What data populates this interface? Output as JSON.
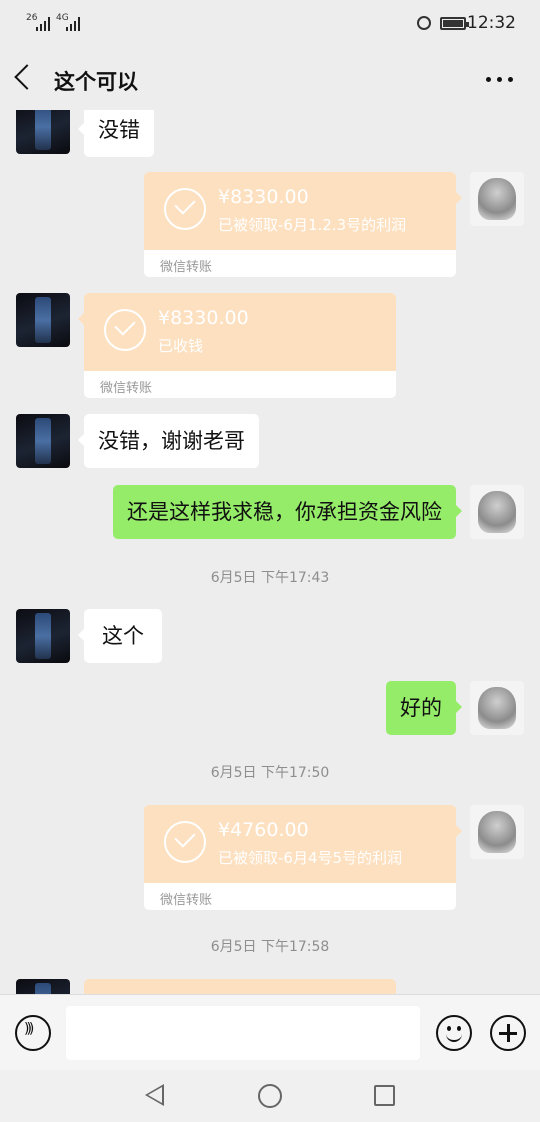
{
  "status_bar": {
    "signal_1": "26",
    "signal_2": "4G",
    "time": "12:32"
  },
  "nav": {
    "title": "这个可以"
  },
  "messages": {
    "m1": "没错",
    "t1": {
      "amount": "¥8330.00",
      "note": "已被领取-6月1.2.3号的利润",
      "footer": "微信转账"
    },
    "t2": {
      "amount": "¥8330.00",
      "note": "已收钱",
      "footer": "微信转账"
    },
    "m2": "没错，谢谢老哥",
    "m3": "还是这样我求稳，你承担资金风险",
    "ts1": "6月5日 下午17:43",
    "m4": "这个",
    "m5": "好的",
    "ts2": "6月5日 下午17:50",
    "t3": {
      "amount": "¥4760.00",
      "note": "已被领取-6月4号5号的利润",
      "footer": "微信转账"
    },
    "ts3": "6月5日 下午17:58"
  },
  "icons": {
    "back": "chevron-left-icon",
    "more": "more-dots-icon",
    "voice": "voice-icon",
    "emoji": "emoji-icon",
    "plus": "plus-icon"
  },
  "colors": {
    "background": "#ededed",
    "sent_bubble": "#95ec69",
    "received_bubble": "#ffffff",
    "transfer": "#fde0c0"
  }
}
